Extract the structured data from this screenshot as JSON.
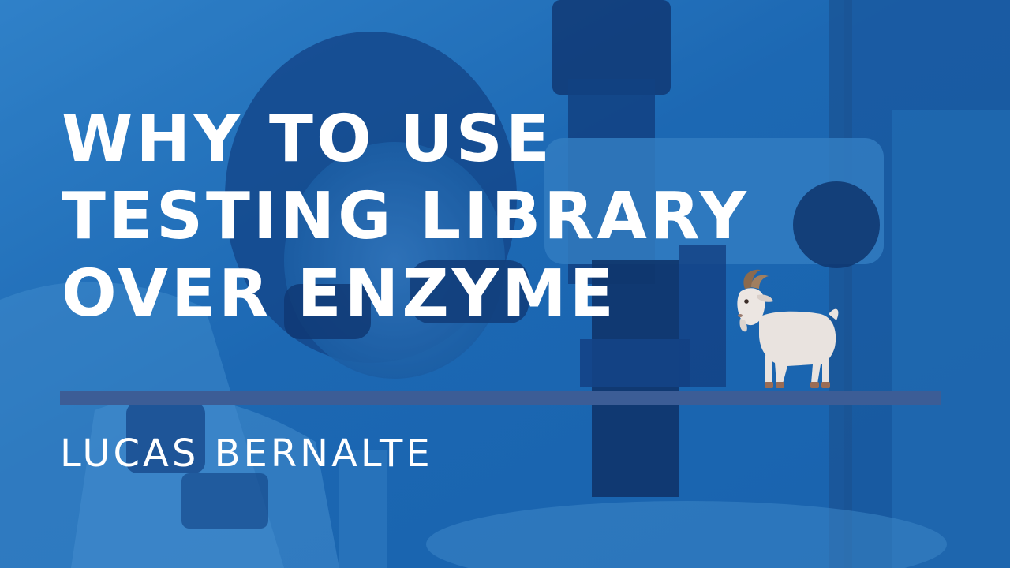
{
  "slide": {
    "title_lines": [
      "WHY TO USE",
      "TESTING LIBRARY",
      "OVER ENZYME"
    ],
    "author": "LUCAS BERNALTE"
  },
  "colors": {
    "background_tint": "#1f6fb8",
    "title_text": "#ffffff",
    "divider": "#3c5d96"
  },
  "icons": {
    "mascot": "goat-icon",
    "background_photo": "scientist-microscope-photo"
  }
}
